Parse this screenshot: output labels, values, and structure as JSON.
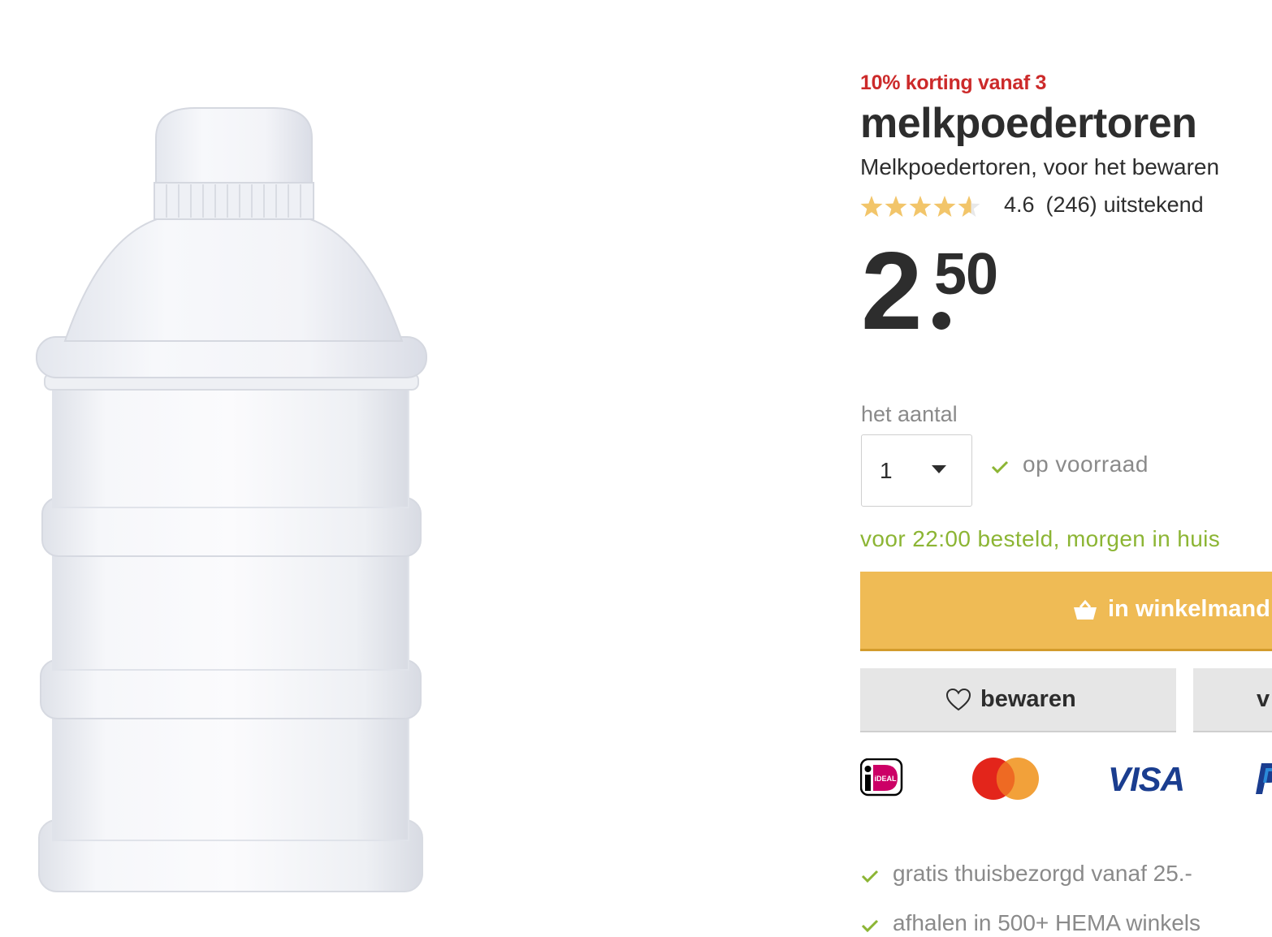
{
  "promo": {
    "text": "10% korting vanaf 3",
    "color": "#cc2a2a"
  },
  "product": {
    "title": "melkpoedertoren",
    "subtitle": "Melkpoedertoren, voor het bewaren",
    "image_alt": "melkpoedertoren product image"
  },
  "rating": {
    "score": "4.6",
    "count": "(246)",
    "label": "uitstekend",
    "stars_value": 4.6,
    "stars_max": 5
  },
  "price": {
    "euros": "2",
    "cents": "50"
  },
  "quantity": {
    "label": "het aantal",
    "selected": "1"
  },
  "stock": {
    "text": "op voorraad"
  },
  "delivery": {
    "text": "voor 22:00 besteld, morgen in huis",
    "color": "#8cb534"
  },
  "cart_button": {
    "label": "in winkelmand",
    "color": "#efbb55",
    "icon": "basket-icon"
  },
  "save_button": {
    "label": "bewaren",
    "icon": "heart-icon"
  },
  "second_button": {
    "label": "v"
  },
  "payments": {
    "ideal": "iDEAL",
    "mastercard": "mastercard-logo",
    "visa": "VISA",
    "paypal": "paypal-logo"
  },
  "usps": [
    {
      "text": "gratis thuisbezorgd vanaf 25.-"
    },
    {
      "text": "afhalen in 500+ HEMA winkels"
    }
  ]
}
